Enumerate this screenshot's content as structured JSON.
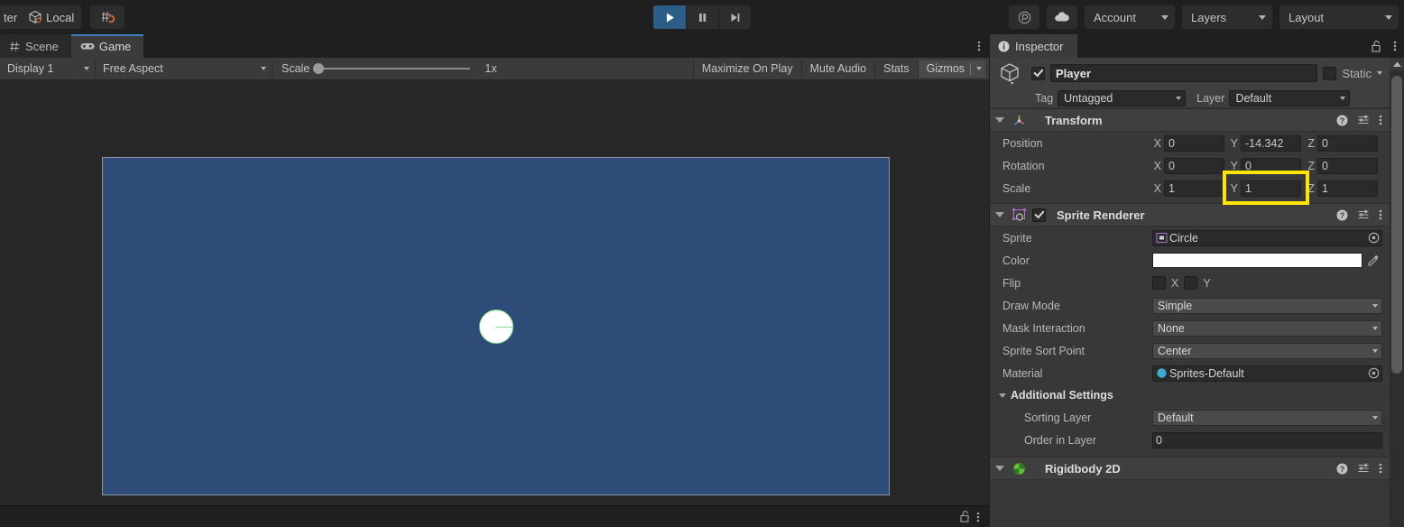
{
  "toolbar": {
    "pivot_label": "ter",
    "local_label": "Local",
    "snap_icon": "grid-snap-icon",
    "play_icon": "play-icon",
    "pause_icon": "pause-icon",
    "step_icon": "step-icon",
    "collab_icon": "plastic-scm-icon",
    "cloud_icon": "cloud-icon",
    "account_label": "Account",
    "layers_label": "Layers",
    "layout_label": "Layout"
  },
  "game_panel": {
    "tabs": [
      {
        "label": "Scene",
        "icon": "scene-grid-icon",
        "active": false
      },
      {
        "label": "Game",
        "icon": "gamepad-icon",
        "active": true
      }
    ],
    "kebab_icon": "kebab-menu-icon",
    "toolbar": {
      "display_label": "Display 1",
      "aspect_label": "Free Aspect",
      "scale_label": "Scale",
      "scale_value": "1x",
      "maximize_label": "Maximize On Play",
      "mute_label": "Mute Audio",
      "stats_label": "Stats",
      "gizmos_label": "Gizmos"
    },
    "canvas": {
      "background_color": "#2F4C78",
      "border_color": "#8b95a5",
      "sprite_name": "player-circle-sprite",
      "sprite_color": "#ffffff",
      "gizmo_color": "#7fe08a"
    },
    "status": {
      "lock_icon": "lock-open-icon",
      "kebab_icon": "kebab-menu-icon"
    }
  },
  "inspector": {
    "tab_label": "Inspector",
    "tab_icon": "info-icon",
    "lock_icon": "lock-open-icon",
    "kebab_icon": "kebab-menu-icon",
    "gameobject": {
      "icon": "cube-icon",
      "enabled": true,
      "name": "Player",
      "static_label": "Static",
      "static_checked": false,
      "tag_label": "Tag",
      "tag_value": "Untagged",
      "layer_label": "Layer",
      "layer_value": "Default"
    },
    "transform": {
      "title": "Transform",
      "icon": "transform-axis-icon",
      "help_icon": "help-icon",
      "preset_icon": "preset-icon",
      "kebab_icon": "kebab-menu-icon",
      "rows": [
        {
          "label": "Position",
          "x": "0",
          "y": "-14.342",
          "z": "0"
        },
        {
          "label": "Rotation",
          "x": "0",
          "y": "0",
          "z": "0"
        },
        {
          "label": "Scale",
          "x": "1",
          "y": "1",
          "z": "1"
        }
      ],
      "axis_labels": [
        "X",
        "Y",
        "Z"
      ],
      "highlight": {
        "field": "position-y",
        "color": "#FFE500"
      }
    },
    "sprite_renderer": {
      "title": "Sprite Renderer",
      "icon": "sprite-renderer-icon",
      "enabled": true,
      "help_icon": "help-icon",
      "preset_icon": "preset-icon",
      "kebab_icon": "kebab-menu-icon",
      "sprite_label": "Sprite",
      "sprite_value": "Circle",
      "sprite_obj_icon": "sprite-asset-icon",
      "picker_icon": "object-picker-icon",
      "color_label": "Color",
      "color_value": "#FFFFFF",
      "eyedropper_icon": "eyedropper-icon",
      "flip_label": "Flip",
      "flip_x_label": "X",
      "flip_y_label": "Y",
      "flip_x": false,
      "flip_y": false,
      "draw_mode_label": "Draw Mode",
      "draw_mode_value": "Simple",
      "mask_interaction_label": "Mask Interaction",
      "mask_interaction_value": "None",
      "sprite_sort_point_label": "Sprite Sort Point",
      "sprite_sort_point_value": "Center",
      "material_label": "Material",
      "material_value": "Sprites-Default",
      "material_obj_icon": "material-asset-icon",
      "additional_settings_label": "Additional Settings",
      "sorting_layer_label": "Sorting Layer",
      "sorting_layer_value": "Default",
      "order_in_layer_label": "Order in Layer",
      "order_in_layer_value": "0"
    },
    "rigidbody2d": {
      "title": "Rigidbody 2D",
      "icon": "rigidbody2d-icon",
      "help_icon": "help-icon",
      "preset_icon": "preset-icon",
      "kebab_icon": "kebab-menu-icon"
    },
    "scrollbar": {
      "up_arrow_icon": "scroll-up-arrow-icon"
    }
  }
}
